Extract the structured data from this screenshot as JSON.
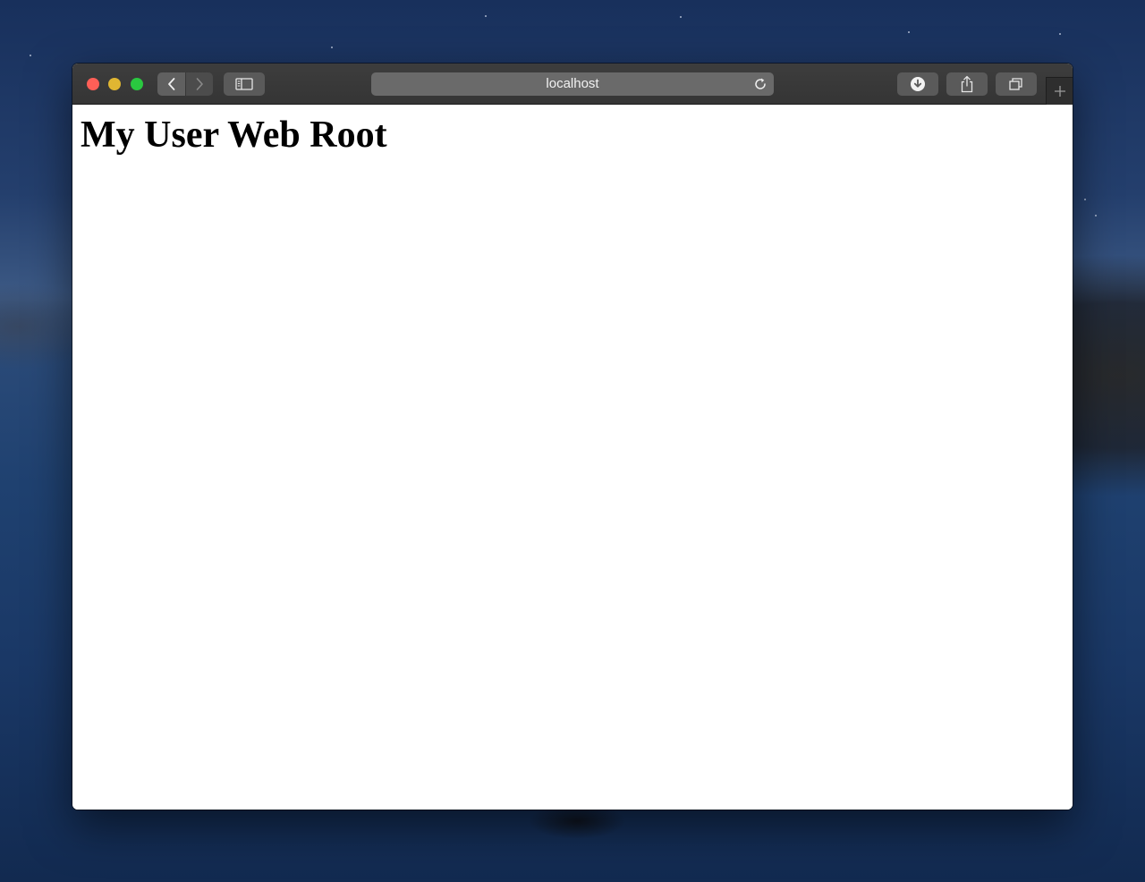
{
  "browser": {
    "address_bar": {
      "url_text": "localhost"
    },
    "icons": {
      "back": "chevron-left-icon",
      "forward": "chevron-right-icon",
      "sidebar": "sidebar-icon",
      "reload": "reload-icon",
      "download": "download-icon",
      "share": "share-icon",
      "tabs": "tab-overview-icon",
      "new_tab": "plus-icon"
    },
    "colors": {
      "close": "#fe5f57",
      "minimize": "#e0b632",
      "maximize": "#2ac840",
      "toolbar": "#3a3a3a"
    }
  },
  "page": {
    "heading": "My User Web Root"
  }
}
